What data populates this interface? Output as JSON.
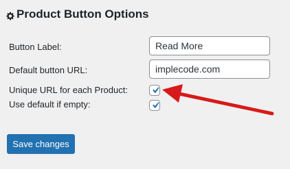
{
  "section": {
    "title": "Product Button Options",
    "icon": "gear-icon"
  },
  "fields": {
    "button_label": {
      "label": "Button Label:",
      "value": "Read More"
    },
    "default_url": {
      "label": "Default button URL:",
      "value": "implecode.com"
    },
    "unique_url": {
      "label": "Unique URL for each Product:",
      "checked": true
    },
    "use_default": {
      "label": "Use default if empty:",
      "checked": true
    }
  },
  "actions": {
    "save_label": "Save changes"
  },
  "annotation": {
    "icon": "red-arrow-icon",
    "color": "#d71a1a"
  },
  "colors": {
    "primary": "#2271b1",
    "checkmark": "#2271b1",
    "background": "#f0f0f1"
  }
}
